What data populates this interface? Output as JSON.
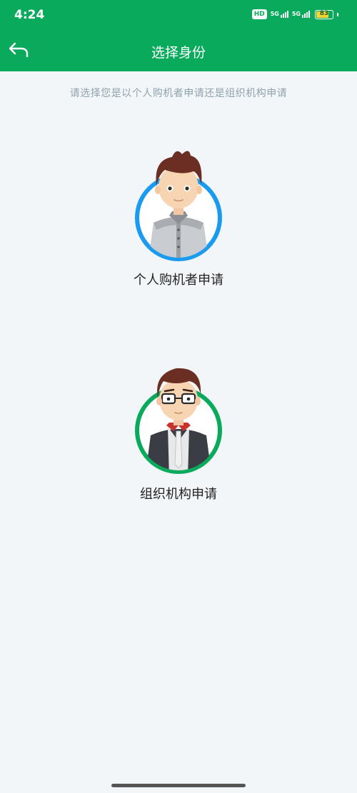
{
  "status_bar": {
    "time": "4:24",
    "hd_label": "HD",
    "sim1_label": "5G",
    "sim2_label": "5G",
    "battery": "83"
  },
  "header": {
    "back_icon": "back-arrow-icon",
    "title": "选择身份"
  },
  "main": {
    "hint": "请选择您是以个人购机者申请还是组织机构申请",
    "options": [
      {
        "label": "个人购机者申请",
        "ring_color": "#1a9bf0"
      },
      {
        "label": "组织机构申请",
        "ring_color": "#0aaa5c"
      }
    ]
  },
  "colors": {
    "brand_green": "#0aaa5c",
    "background": "#f3f6f8",
    "hint_text": "#8ea3ad"
  }
}
